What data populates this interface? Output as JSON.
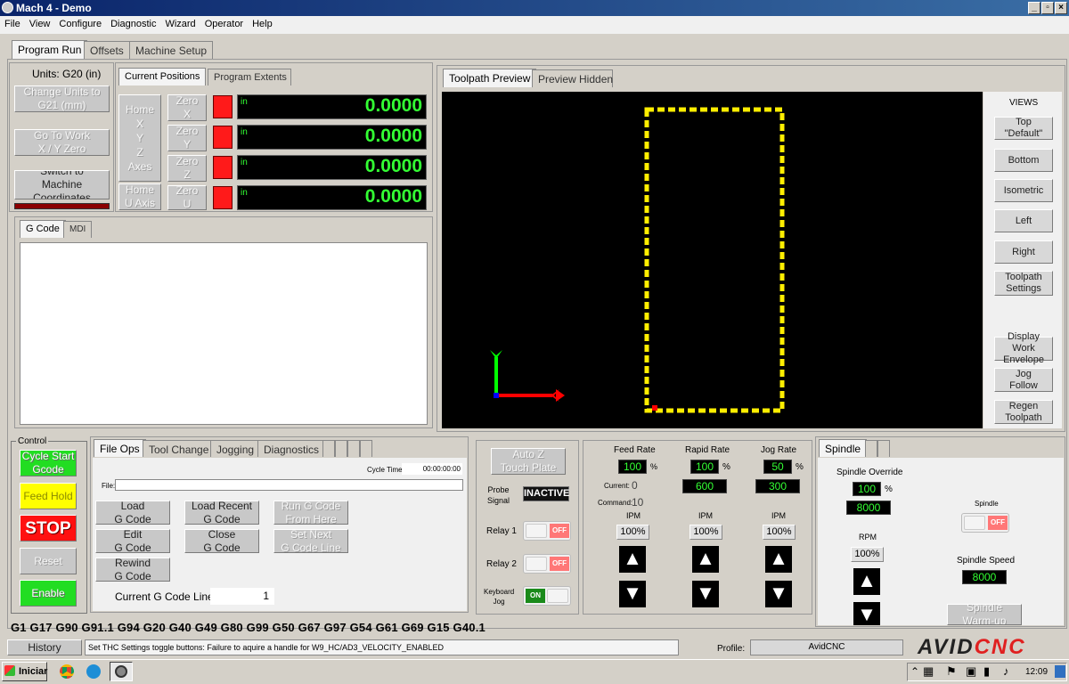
{
  "window": {
    "title": "Mach 4 - Demo"
  },
  "menu": [
    "File",
    "View",
    "Configure",
    "Diagnostic",
    "Wizard",
    "Operator",
    "Help"
  ],
  "main_tabs": [
    "Program Run",
    "Offsets",
    "Machine Setup"
  ],
  "units": {
    "label": "Units: G20 (in)",
    "change_units": "Change Units to\nG21 (mm)",
    "go_to_zero": "Go To Work\nX / Y Zero",
    "switch_coords": "Switch to\nMachine Coordinates"
  },
  "positions": {
    "tabs": [
      "Current Positions",
      "Program Extents"
    ],
    "home_xyz": "Home\nX\nY\nZ\nAxes",
    "home_u": "Home\nU  Axis",
    "zero": [
      "Zero\nX",
      "Zero\nY",
      "Zero\nZ",
      "Zero\nU"
    ],
    "unit": "in",
    "values": [
      "0.0000",
      "0.0000",
      "0.0000",
      "0.0000"
    ]
  },
  "gcode": {
    "tabs": [
      "G Code",
      "MDI"
    ]
  },
  "preview": {
    "tabs": [
      "Toolpath Preview",
      "Preview Hidden"
    ],
    "views_title": "VIEWS",
    "views": [
      "Top\n\"Default\"",
      "Bottom",
      "Isometric",
      "Left",
      "Right",
      "Toolpath\nSettings"
    ],
    "views2": [
      "Display Work\nEnvelope",
      "Jog\nFollow",
      "Regen\nToolpath"
    ],
    "colors": {
      "toolpath": "#ffee00",
      "x_axis": "#ff0000",
      "y_axis": "#00ff00",
      "background": "#000000"
    }
  },
  "control": {
    "title": "Control",
    "cycle_start": "Cycle Start\nGcode",
    "feed_hold": "Feed Hold",
    "stop": "STOP",
    "reset": "Reset",
    "enable": "Enable"
  },
  "fileops": {
    "tabs": [
      "File Ops",
      "Tool Change",
      "Jogging",
      "Diagnostics"
    ],
    "cycle_time_label": "Cycle Time:",
    "cycle_time": "00:00:00:00",
    "file_label": "File:",
    "file_value": "",
    "load": "Load\nG Code",
    "load_recent": "Load Recent\nG Code",
    "run_from_here": "Run G Code\nFrom Here",
    "edit": "Edit\nG Code",
    "close": "Close\nG Code",
    "set_next": "Set Next\nG Code Line",
    "rewind": "Rewind\nG Code",
    "current_line_label": "Current G Code Line:",
    "current_line": "1"
  },
  "probe": {
    "auto_z": "Auto Z\nTouch Plate",
    "signal_label": "Probe\nSignal",
    "signal_value": "INACTIVE",
    "relay1": "Relay 1",
    "relay2": "Relay 2",
    "keyboard_jog": "Keyboard\nJog",
    "off": "OFF",
    "on": "ON"
  },
  "rates": {
    "feed_label": "Feed Rate",
    "rapid_label": "Rapid Rate",
    "jog_label": "Jog Rate",
    "feed_pct": "100",
    "rapid_pct": "100",
    "jog_pct": "50",
    "percent": "%",
    "current_label": "Current:",
    "current_value": "0",
    "command_label": "Command:",
    "command_value": "10",
    "rapid_value": "600",
    "jog_value": "300",
    "ipm": "IPM",
    "btn_100": "100%"
  },
  "spindle": {
    "tab": "Spindle",
    "override_label": "Spindle Override",
    "override_pct": "100",
    "percent": "%",
    "rpm_value": "8000",
    "rpm_label": "RPM",
    "btn_100": "100%",
    "spindle_label": "Spindle",
    "off": "OFF",
    "speed_label": "Spindle Speed",
    "speed_value": "8000",
    "warmup": "Spindle\nWarm-up"
  },
  "gcode_modal": "G1 G17 G90 G91.1 G94 G20 G40 G49 G80 G99 G50 G67 G97 G54 G61 G69 G15 G40.1",
  "status": {
    "history": "History",
    "message": "Set THC Settings toggle buttons: Failure to aquire a handle for W9_HC/AD3_VELOCITY_ENABLED",
    "profile_label": "Profile:",
    "profile_value": "AvidCNC",
    "logo": "AVIDCNC"
  },
  "taskbar": {
    "start": "Iniciar",
    "time": "12:09"
  }
}
